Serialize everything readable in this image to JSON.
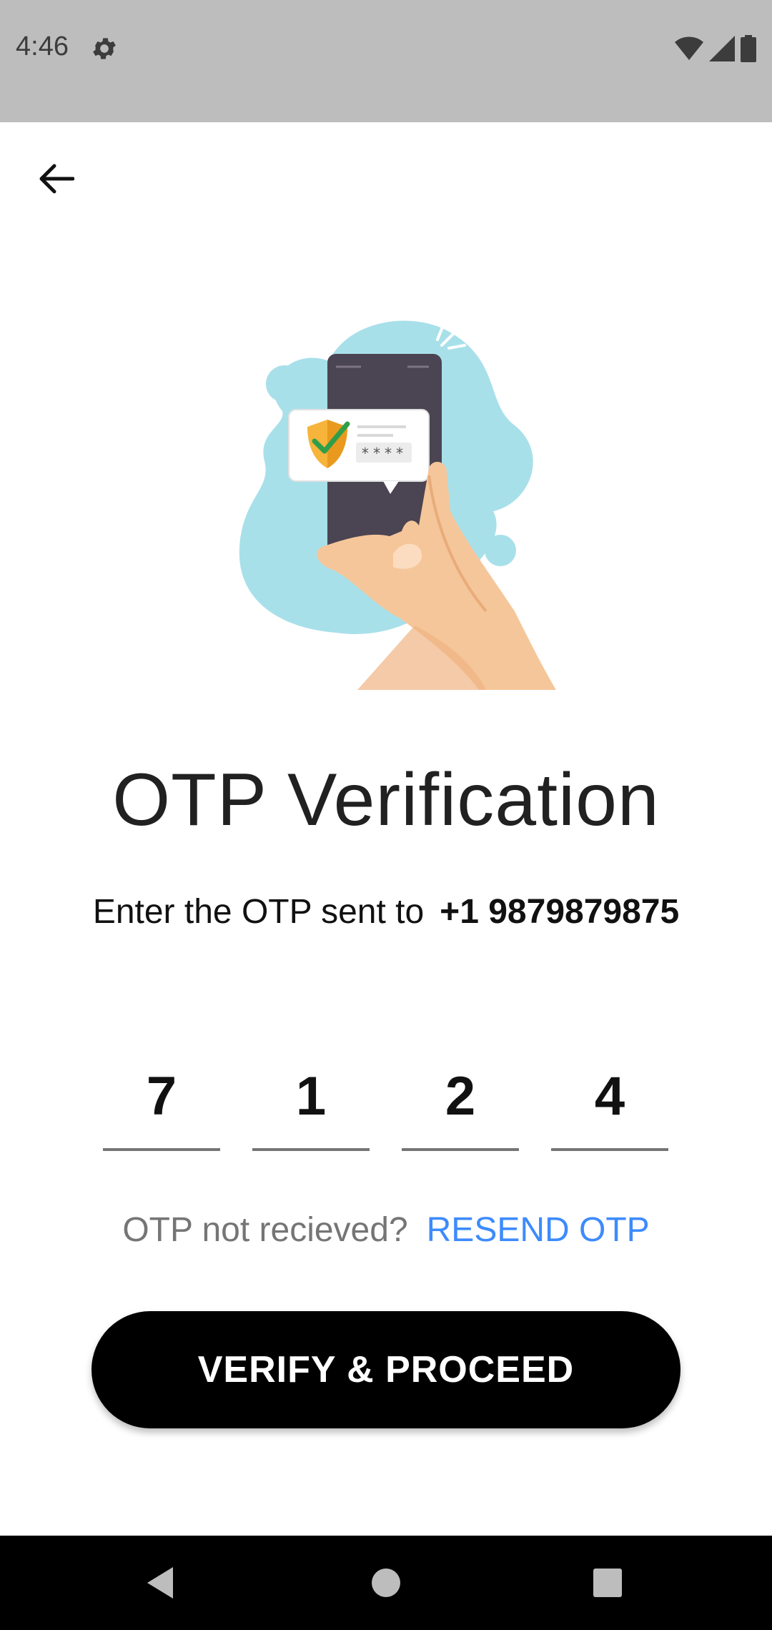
{
  "status_bar": {
    "time": "4:46",
    "icons": [
      "settings-icon",
      "wifi-icon",
      "signal-icon",
      "battery-icon"
    ]
  },
  "app_bar": {
    "back_icon": "arrow-left-icon"
  },
  "illustration": {
    "masked_code": "****"
  },
  "title": "OTP Verification",
  "subtitle": {
    "text": "Enter the OTP sent to",
    "phone": "+1 9879879875"
  },
  "otp": {
    "digits": [
      "7",
      "1",
      "2",
      "4"
    ]
  },
  "resend": {
    "label": "OTP not recieved?",
    "link": "RESEND OTP"
  },
  "verify_button": {
    "label": "VERIFY & PROCEED"
  },
  "colors": {
    "status_bar": "#bdbdbd",
    "link": "#3d8bfd",
    "button": "#000000",
    "blob": "#a8e0ea"
  },
  "nav_bar": {
    "icons": [
      "back-triangle-icon",
      "home-circle-icon",
      "recents-square-icon"
    ]
  }
}
